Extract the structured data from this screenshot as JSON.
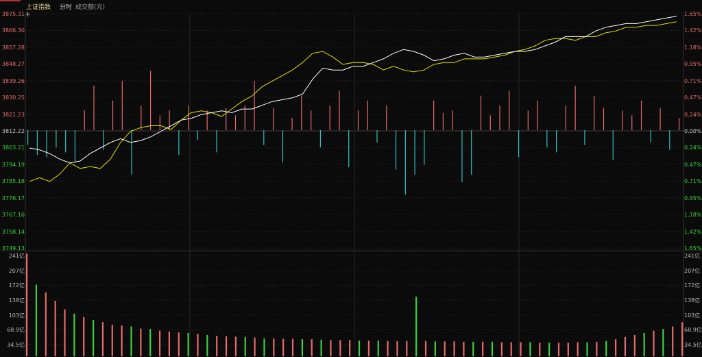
{
  "header": {
    "title": "上证指数",
    "tabs": [
      "分时",
      "成交额(元)"
    ]
  },
  "colors": {
    "background": "#0b0b0b",
    "grid": "#262626",
    "up": "#e86b6b",
    "down": "#2fc0c0",
    "green_text": "#37d637",
    "price_line": "#ffffff",
    "avg_line": "#e2e100",
    "title": "#e6d89a"
  },
  "price_axis": {
    "prices": [
      "3875.31",
      "3866.30",
      "3857.28",
      "3848.27",
      "3839.26",
      "3830.25",
      "3821.23",
      "3812.22",
      "3803.21",
      "3794.19",
      "3785.18",
      "3776.17",
      "3767.16",
      "3758.14",
      "3749.13"
    ],
    "percents": [
      "1.65%",
      "1.42%",
      "1.18%",
      "0.95%",
      "0.71%",
      "0.47%",
      "0.24%",
      "0.00%",
      "0.24%",
      "0.47%",
      "0.71%",
      "0.95%",
      "1.18%",
      "1.42%",
      "1.65%"
    ],
    "base": 3812.22,
    "max": 3875.31,
    "min": 3749.13
  },
  "volume_axis": {
    "labels": [
      "241亿",
      "207亿",
      "172亿",
      "138亿",
      "103亿",
      "68.9亿",
      "34.5亿"
    ],
    "max_yi": 241
  },
  "chart_data": {
    "type": "line",
    "title": "上证指数",
    "ylim": [
      3749.13,
      3875.31
    ],
    "price": [
      3803,
      3802,
      3800,
      3797,
      3795,
      3796,
      3800,
      3803,
      3806,
      3808,
      3806,
      3807,
      3809,
      3812,
      3815,
      3818,
      3819,
      3821,
      3822,
      3823,
      3822,
      3824,
      3824,
      3826,
      3828,
      3829,
      3830,
      3832,
      3840,
      3846,
      3845,
      3845,
      3847,
      3847,
      3849,
      3851,
      3854,
      3856,
      3855,
      3853,
      3850,
      3851,
      3853,
      3854,
      3852,
      3852,
      3853,
      3854,
      3855,
      3855,
      3856,
      3858,
      3860,
      3863,
      3863,
      3863,
      3866,
      3868,
      3869,
      3870,
      3870,
      3871,
      3872,
      3873,
      3874
    ],
    "average": [
      3785,
      3787,
      3785,
      3789,
      3795,
      3792,
      3793,
      3792,
      3797,
      3806,
      3812,
      3814,
      3815,
      3815,
      3813,
      3818,
      3822,
      3823,
      3822,
      3820,
      3824,
      3828,
      3831,
      3836,
      3839,
      3842,
      3845,
      3849,
      3854,
      3855,
      3852,
      3848,
      3849,
      3849,
      3848,
      3845,
      3847,
      3845,
      3844,
      3845,
      3848,
      3849,
      3849,
      3851,
      3851,
      3851,
      3852,
      3853,
      3855,
      3856,
      3858,
      3861,
      3862,
      3862,
      3861,
      3863,
      3863,
      3865,
      3866,
      3868,
      3868,
      3869,
      3869,
      3870,
      3871
    ],
    "net_flow": [
      -6,
      -10,
      -11,
      -7,
      -9,
      -13,
      8,
      18,
      -8,
      12,
      20,
      -18,
      10,
      24,
      6,
      8,
      -10,
      10,
      -4,
      8,
      -9,
      9,
      6,
      10,
      20,
      -6,
      9,
      -13,
      5,
      14,
      8,
      -7,
      10,
      16,
      -15,
      8,
      12,
      -5,
      10,
      -16,
      -26,
      -18,
      -14,
      12,
      7,
      8,
      -21,
      -18,
      14,
      6,
      10,
      16,
      -11,
      8,
      12,
      -7,
      -9,
      10,
      18,
      -6,
      14,
      9,
      -12,
      8,
      6,
      12,
      -5,
      9,
      -8,
      5
    ],
    "volume": [
      241,
      168,
      150,
      130,
      110,
      100,
      92,
      85,
      80,
      74,
      72,
      70,
      65,
      64,
      60,
      58,
      56,
      55,
      53,
      50,
      48,
      47,
      46,
      45,
      44,
      42,
      42,
      41,
      41,
      40,
      40,
      39,
      38,
      38,
      38,
      37,
      37,
      37,
      36,
      36,
      36,
      140,
      36,
      35,
      35,
      35,
      34,
      34,
      34,
      34,
      33,
      33,
      33,
      33,
      32,
      32,
      32,
      32,
      33,
      33,
      34,
      36,
      40,
      45,
      50,
      55,
      60,
      64,
      70,
      80
    ]
  }
}
